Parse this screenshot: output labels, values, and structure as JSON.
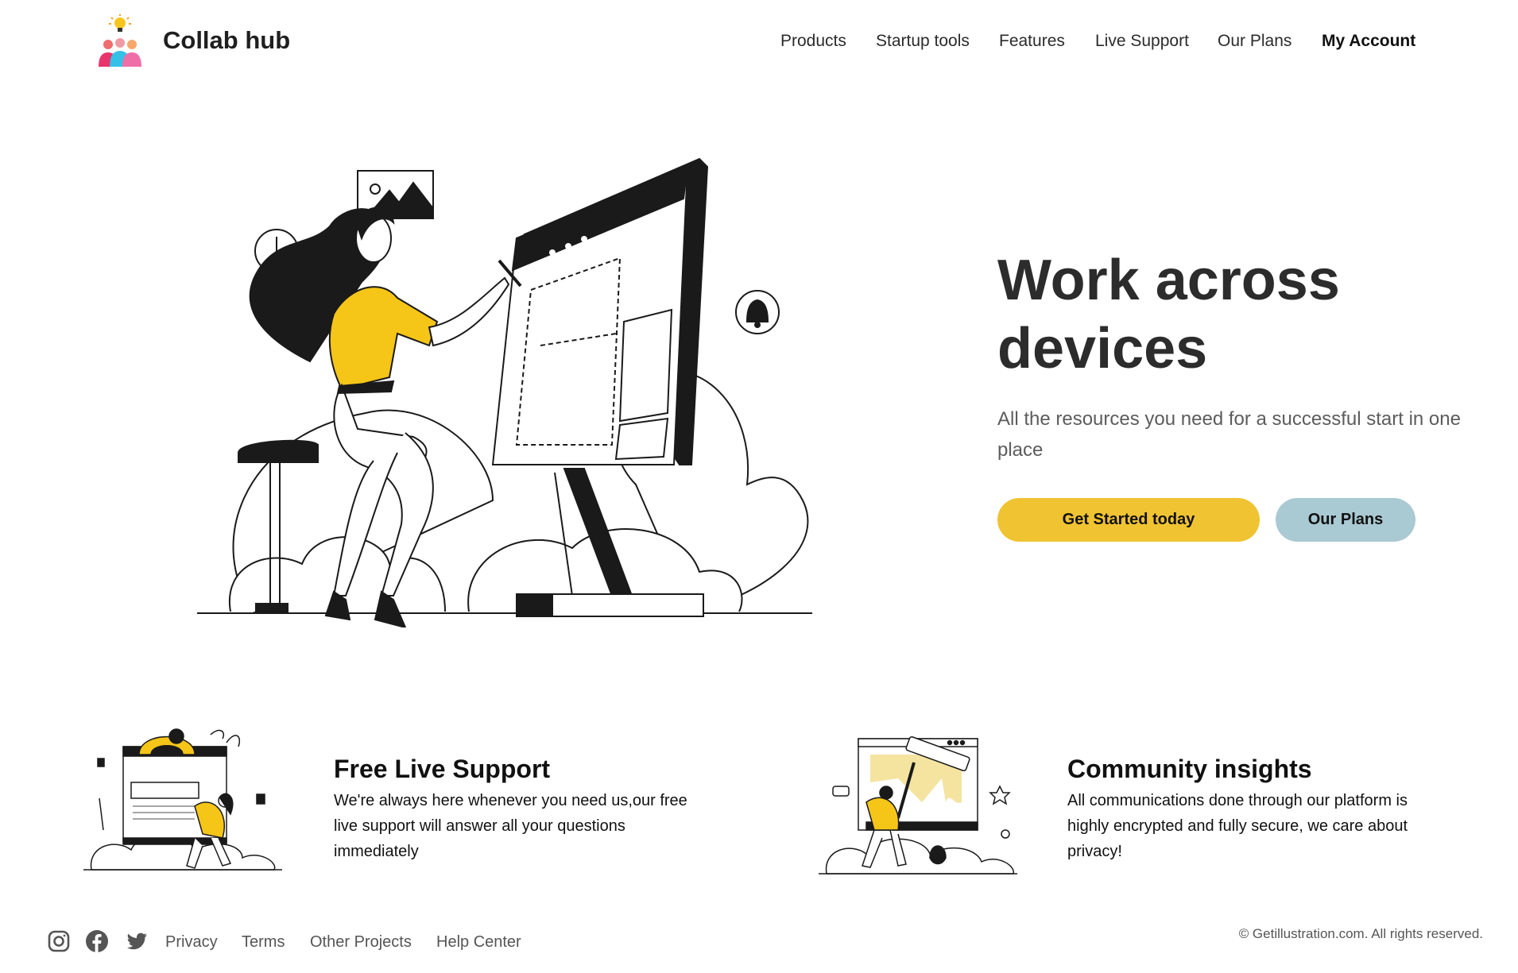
{
  "header": {
    "brand": "Collab hub",
    "logo_icon": "lightbulb-people-logo",
    "nav": [
      {
        "label": "Products"
      },
      {
        "label": "Startup tools"
      },
      {
        "label": "Features"
      },
      {
        "label": "Live Support"
      },
      {
        "label": "Our Plans"
      },
      {
        "label": "My Account"
      }
    ]
  },
  "hero": {
    "title_line1": "Work across",
    "title_line2": "devices",
    "subtitle": "All the resources you need for a successful start in one place",
    "primary_button": "Get Started today",
    "secondary_button": "Our Plans",
    "illustration": "woman-drawing-on-screen-illustration"
  },
  "features": [
    {
      "title": "Free Live Support",
      "description": "We're always here whenever you need us,our free live support will answer all your questions immediately",
      "illustration": "support-people-illustration"
    },
    {
      "title": "Community insights",
      "description": "All communications done through our platform is highly encrypted and fully secure, we care about privacy!",
      "illustration": "painter-roller-illustration"
    }
  ],
  "footer": {
    "social": [
      "instagram-icon",
      "facebook-icon",
      "twitter-icon"
    ],
    "links": [
      {
        "label": "Privacy"
      },
      {
        "label": "Terms"
      },
      {
        "label": "Other Projects"
      },
      {
        "label": "Help Center"
      }
    ],
    "copyright": "© Getillustration.com. All rights reserved."
  },
  "colors": {
    "accent_yellow": "#f0c332",
    "secondary_blue": "#a9c9d3",
    "text_dark": "#2c2c2c",
    "text_muted": "#5c5c5c"
  }
}
